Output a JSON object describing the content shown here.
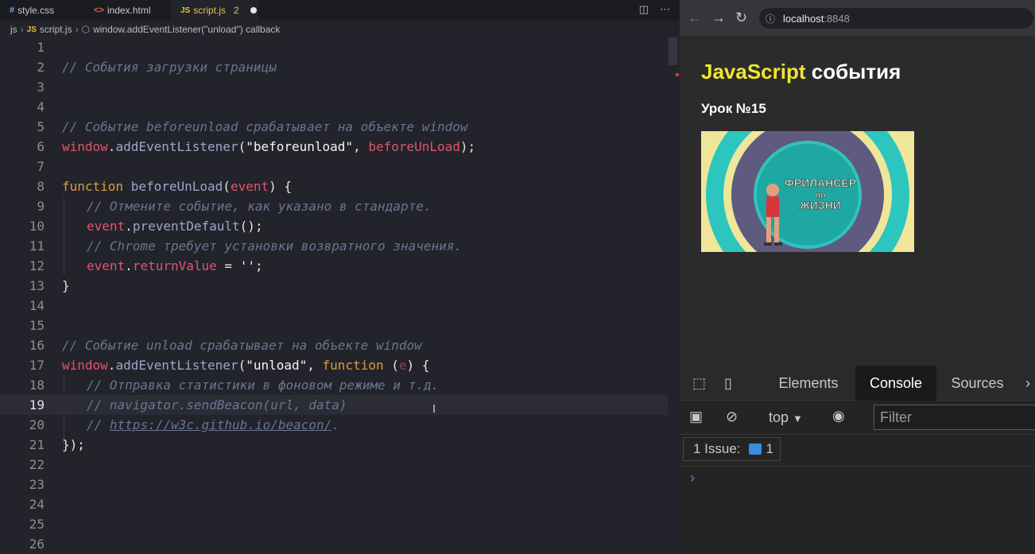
{
  "editor": {
    "tabs": [
      {
        "icon": "#",
        "label": "style.css"
      },
      {
        "icon": "<>",
        "label": "index.html"
      },
      {
        "icon": "JS",
        "label": "script.js",
        "problems": "2"
      }
    ],
    "breadcrumb": [
      "js",
      "script.js",
      "window.addEventListener(\"unload\") callback"
    ],
    "line_numbers": [
      "1",
      "2",
      "3",
      "4",
      "5",
      "6",
      "7",
      "8",
      "9",
      "10",
      "11",
      "12",
      "13",
      "14",
      "15",
      "16",
      "17",
      "18",
      "19",
      "20",
      "21",
      "22",
      "23",
      "24",
      "25",
      "26"
    ],
    "current_line": "19",
    "code": {
      "l2": "// События загрузки страницы",
      "l5": "// Событие beforeunload срабатывает на объекте window",
      "l6_obj": "window",
      "l6_fn": "addEventListener",
      "l6_str": "\"beforeunload\"",
      "l6_arg": "beforeUnLoad",
      "l8_kw": "function",
      "l8_fn": "beforeUnLoad",
      "l8_param": "event",
      "l9": "// Отмените событие, как указано в стандарте.",
      "l10_obj": "event",
      "l10_fn": "preventDefault",
      "l11": "// Chrome требует установки возвратного значения.",
      "l12_obj": "event",
      "l12_prop": "returnValue",
      "l12_str": "''",
      "l13": "}",
      "l16": "// Событие unload срабатывает на объекте window",
      "l17_obj": "window",
      "l17_fn": "addEventListener",
      "l17_str": "\"unload\"",
      "l17_kw": "function",
      "l17_param": "e",
      "l18": "// Отправка статистики в фоновом режиме и т.д.",
      "l19": "// navigator.sendBeacon(url, data)",
      "l20_prefix": "// ",
      "l20_link": "https://w3c.github.io/beacon/",
      "l20_suffix": ".",
      "l21": "});"
    }
  },
  "browser": {
    "url_host": "localhost",
    "url_port": ":8848",
    "page_title_highlight": "JavaScript",
    "page_title_rest": " события",
    "lesson": "Урок №15",
    "thumbnail_text": [
      "ФРИЛАНСЕР",
      "по",
      "ЖИЗНИ"
    ]
  },
  "devtools": {
    "tabs": [
      "Elements",
      "Console",
      "Sources"
    ],
    "active_tab": "Console",
    "context": "top",
    "filter_placeholder": "Filter",
    "issues_label": "1 Issue:",
    "issues_count": "1",
    "prompt": "›"
  },
  "colors": {
    "editor_bg": "#22232b",
    "keyword": "#e09b3d",
    "variable": "#e0556b",
    "comment": "#6a7591",
    "highlight": "#f0e52f"
  }
}
